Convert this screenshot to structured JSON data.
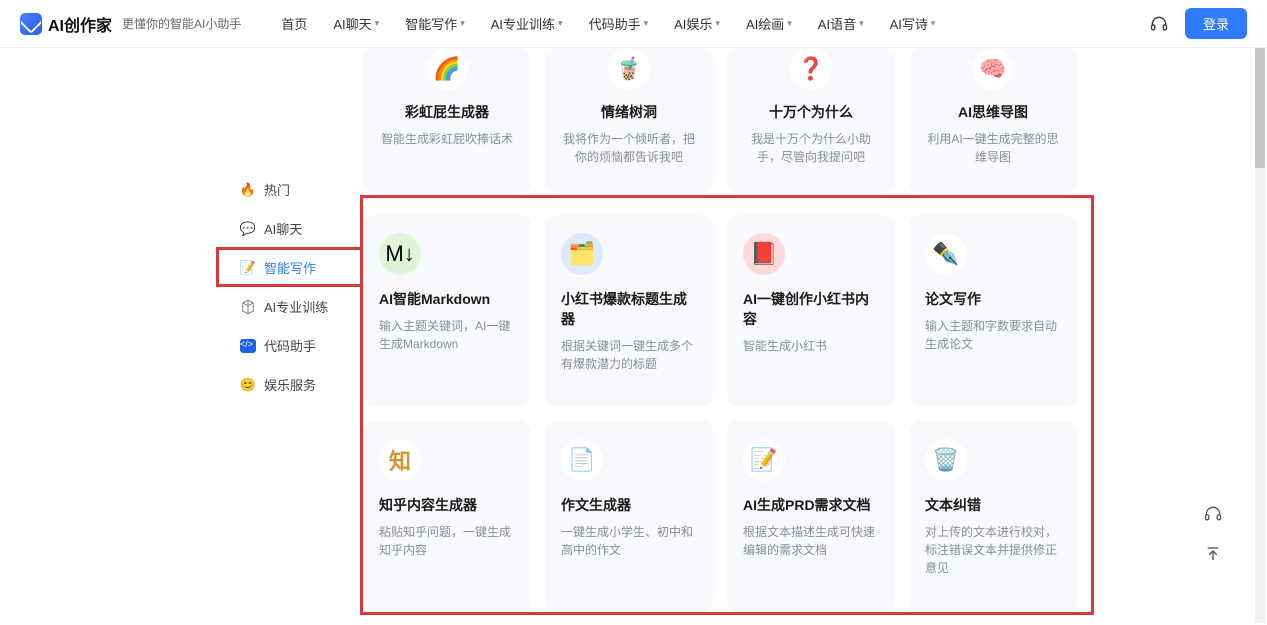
{
  "brand": "AI创作家",
  "tagline": "更懂你的智能AI小助手",
  "nav": [
    "首页",
    "AI聊天",
    "智能写作",
    "AI专业训练",
    "代码助手",
    "AI娱乐",
    "AI绘画",
    "AI语音",
    "AI写诗"
  ],
  "nav_dropdown": [
    false,
    true,
    true,
    true,
    true,
    true,
    true,
    true,
    true
  ],
  "login": "登录",
  "sidebar": [
    {
      "icon": "fire",
      "label": "热门"
    },
    {
      "icon": "chat",
      "label": "AI聊天"
    },
    {
      "icon": "edit",
      "label": "智能写作"
    },
    {
      "icon": "cube",
      "label": "AI专业训练"
    },
    {
      "icon": "code",
      "label": "代码助手"
    },
    {
      "icon": "smile",
      "label": "娱乐服务"
    }
  ],
  "sidebar_active": 2,
  "top_row": [
    {
      "emoji": "🌈",
      "title": "彩虹屁生成器",
      "desc": "智能生成彩虹屁吹捧话术"
    },
    {
      "emoji": "🧋",
      "title": "情绪树洞",
      "desc": "我将作为一个倾听者，把你的烦恼都告诉我吧"
    },
    {
      "emoji": "❓",
      "title": "十万个为什么",
      "desc": "我是十万个为什么小助手，尽管向我提问吧"
    },
    {
      "emoji": "🧠",
      "title": "AI思维导图",
      "desc": "利用AI一键生成完整的思维导图"
    }
  ],
  "cards": [
    {
      "emoji": "M↓",
      "title": "AI智能Markdown",
      "desc": "输入主题关键词，AI一键生成Markdown",
      "iconbg": "#e0f5d8"
    },
    {
      "emoji": "🗂️",
      "title": "小红书爆款标题生成器",
      "desc": "根据关键词一键生成多个有爆款潜力的标题",
      "iconbg": "#dceaff"
    },
    {
      "emoji": "📕",
      "title": "AI一键创作小红书内容",
      "desc": "智能生成小红书",
      "iconbg": "#ffd9d8"
    },
    {
      "emoji": "✒️",
      "title": "论文写作",
      "desc": "输入主题和字数要求自动生成论文",
      "iconbg": "#fff"
    },
    {
      "emoji": "知",
      "title": "知乎内容生成器",
      "desc": "粘贴知乎问题，一键生成知乎内容",
      "iconbg": "#fff",
      "color": "#d89430"
    },
    {
      "emoji": "📄",
      "title": "作文生成器",
      "desc": "一键生成小学生、初中和高中的作文",
      "iconbg": "#fff"
    },
    {
      "emoji": "📝",
      "title": "AI生成PRD需求文档",
      "desc": "根据文本描述生成可快速编辑的需求文档",
      "iconbg": "#fff"
    },
    {
      "emoji": "🗑️",
      "title": "文本纠错",
      "desc": "对上传的文本进行校对，标注错误文本并提供修正意见",
      "iconbg": "#fff"
    }
  ]
}
